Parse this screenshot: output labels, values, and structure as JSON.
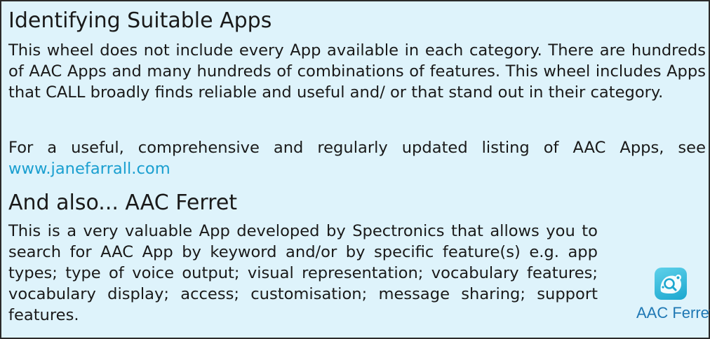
{
  "section1": {
    "heading": "Identifying Suitable Apps",
    "paragraph": "This wheel does not include every App available in each category. There are hundreds of AAC Apps and many hundreds of combinations of features. This wheel includes Apps that CALL broadly finds reliable and useful and/ or that stand out in their category.",
    "listing_text": "For a useful, comprehensive and regularly updated listing of AAC Apps, see",
    "link_text": "www.janefarrall.com"
  },
  "section2": {
    "heading": "And also... AAC Ferret",
    "paragraph": "This is a very valuable App developed by Spectronics that allows you to search for AAC App by keyword and/or by specific feature(s) e.g. app types; type of voice output; visual representation; vocabulary features; vocabulary display; access; customisation; message sharing; support features.",
    "app_icon": "ferret-app-icon",
    "app_label": "AAC Ferret"
  },
  "colors": {
    "background": "#def3fb",
    "border": "#2a2a2a",
    "link": "#1a9fd0",
    "app_label": "#1f78b4"
  }
}
